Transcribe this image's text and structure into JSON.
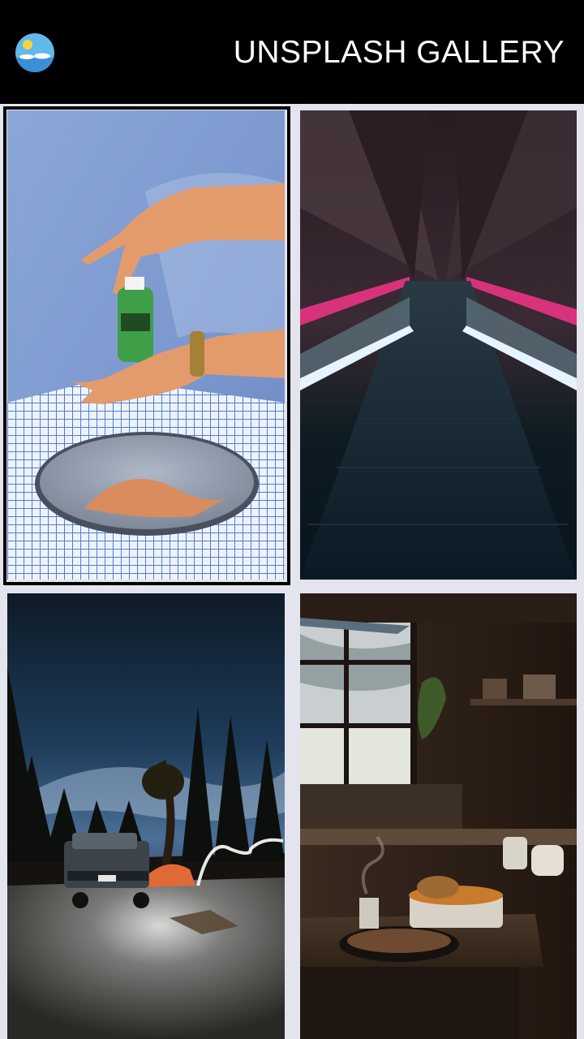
{
  "app": {
    "title": "UNSPLASH GALLERY",
    "logo_icon": "sunny-landscape-icon"
  },
  "colors": {
    "appbar": "#000000",
    "background": "#e4e4ee",
    "selection": "#000000"
  },
  "gallery": {
    "selected_index": 0,
    "photos": [
      {
        "icon": "hand-sanitizer-photo"
      },
      {
        "icon": "neon-escalator-photo"
      },
      {
        "icon": "night-camp-photo"
      },
      {
        "icon": "rustic-kitchen-photo"
      }
    ]
  }
}
